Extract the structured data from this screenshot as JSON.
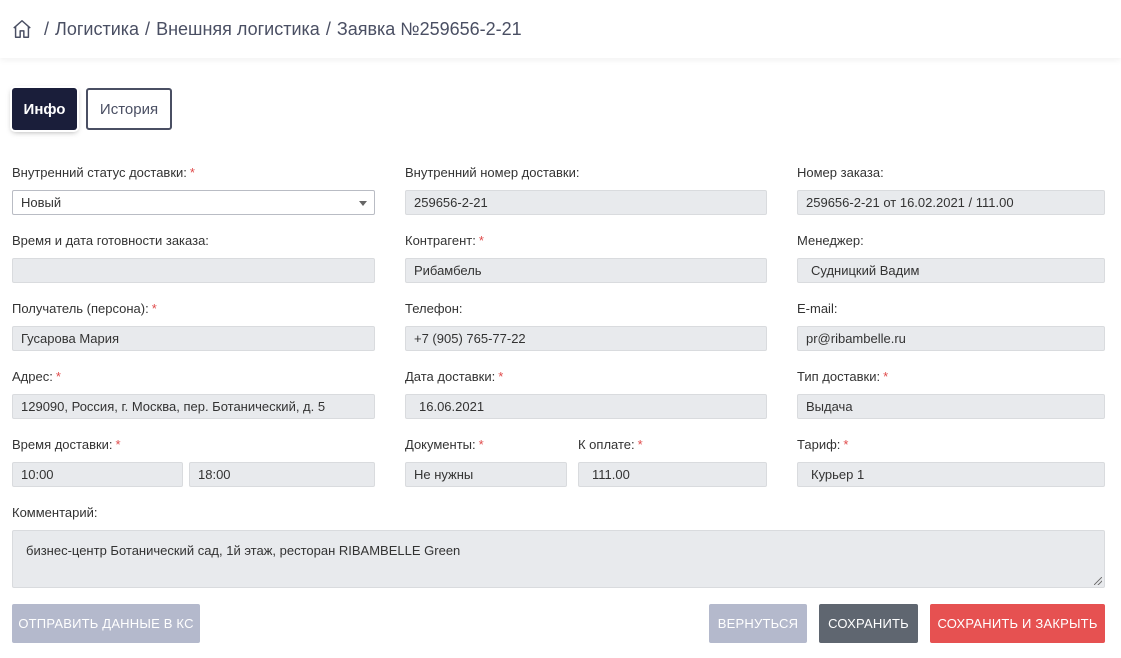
{
  "breadcrumb": {
    "items": [
      "Логистика",
      "Внешняя логистика",
      "Заявка №259656-2-21"
    ],
    "separator": "/"
  },
  "tabs": {
    "info": "Инфо",
    "history": "История"
  },
  "form": {
    "internal_status": {
      "label": "Внутренний статус доставки:",
      "value": "Новый"
    },
    "internal_number": {
      "label": "Внутренний номер доставки:",
      "value": "259656-2-21"
    },
    "order_number": {
      "label": "Номер заказа:",
      "value": "259656-2-21 от 16.02.2021 / 111.00"
    },
    "ready_time": {
      "label": "Время и дата готовности заказа:",
      "value": ""
    },
    "counterparty": {
      "label": "Контрагент:",
      "value": "Рибамбель"
    },
    "manager": {
      "label": "Менеджер:",
      "value": "Судницкий Вадим"
    },
    "recipient": {
      "label": "Получатель (персона):",
      "value": "Гусарова Мария"
    },
    "phone": {
      "label": "Телефон:",
      "value": "+7 (905) 765-77-22"
    },
    "email": {
      "label": "E-mail:",
      "value": "pr@ribambelle.ru"
    },
    "address": {
      "label": "Адрес:",
      "value": "129090, Россия, г. Москва, пер. Ботанический, д. 5"
    },
    "delivery_date": {
      "label": "Дата доставки:",
      "value": "16.06.2021"
    },
    "delivery_type": {
      "label": "Тип доставки:",
      "value": "Выдача"
    },
    "delivery_time": {
      "label": "Время доставки:",
      "from": "10:00",
      "to": "18:00"
    },
    "documents": {
      "label": "Документы:",
      "value": "Не нужны"
    },
    "to_pay": {
      "label": "К оплате:",
      "value": "111.00"
    },
    "tariff": {
      "label": "Тариф:",
      "value": "Курьер 1"
    },
    "comment": {
      "label": "Комментарий:",
      "value": "бизнес-центр Ботанический сад, 1й этаж, ресторан RIBAMBELLE Green"
    },
    "required_mark": "*"
  },
  "buttons": {
    "send": "Отправить данные в КС",
    "back": "Вернуться",
    "save": "Сохранить",
    "save_close": "Сохранить и закрыть"
  },
  "colors": {
    "accent_dark": "#1a1e3a",
    "danger": "#e65151",
    "muted_button": "#b4b9cc",
    "save_button": "#5f6670",
    "required": "#e04a4a"
  }
}
